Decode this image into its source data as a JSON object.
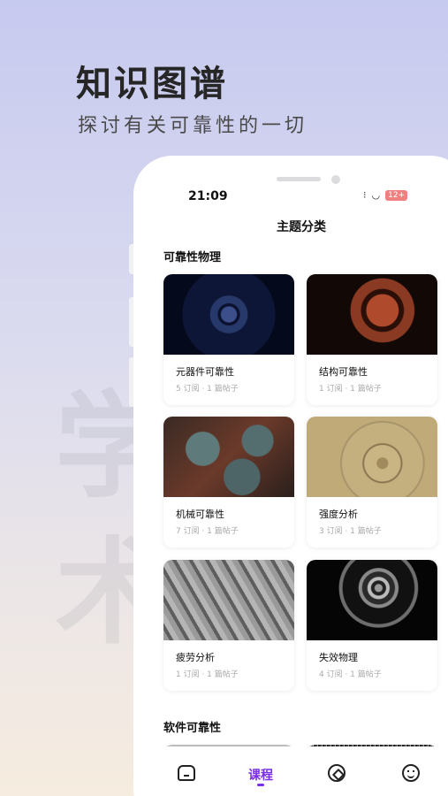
{
  "hero": {
    "title": "知识图谱",
    "subtitle": "探讨有关可靠性的一切"
  },
  "background_chars": [
    "学",
    "术"
  ],
  "status_bar": {
    "time": "21:09",
    "battery": "12+"
  },
  "nav": {
    "title": "主题分类"
  },
  "sections": [
    {
      "title": "可靠性物理",
      "cards": [
        {
          "name": "元器件可靠性",
          "meta": "5 订阅 · 1 篇帖子"
        },
        {
          "name": "结构可靠性",
          "meta": "1 订阅 · 1 篇帖子"
        },
        {
          "name": "机械可靠性",
          "meta": "7 订阅 · 1 篇帖子"
        },
        {
          "name": "强度分析",
          "meta": "3 订阅 · 1 篇帖子"
        },
        {
          "name": "疲劳分析",
          "meta": "1 订阅 · 1 篇帖子"
        },
        {
          "name": "失效物理",
          "meta": "4 订阅 · 1 篇帖子"
        }
      ]
    },
    {
      "title": "软件可靠性",
      "cards": []
    }
  ],
  "tabbar": {
    "course_label": "课程",
    "active": "课程"
  },
  "icons": [
    "home-icon",
    "compass-icon",
    "smile-icon",
    "wifi-icon",
    "signal-icon"
  ],
  "colors": {
    "accent": "#7a2ee6",
    "battery": "#f08080"
  }
}
